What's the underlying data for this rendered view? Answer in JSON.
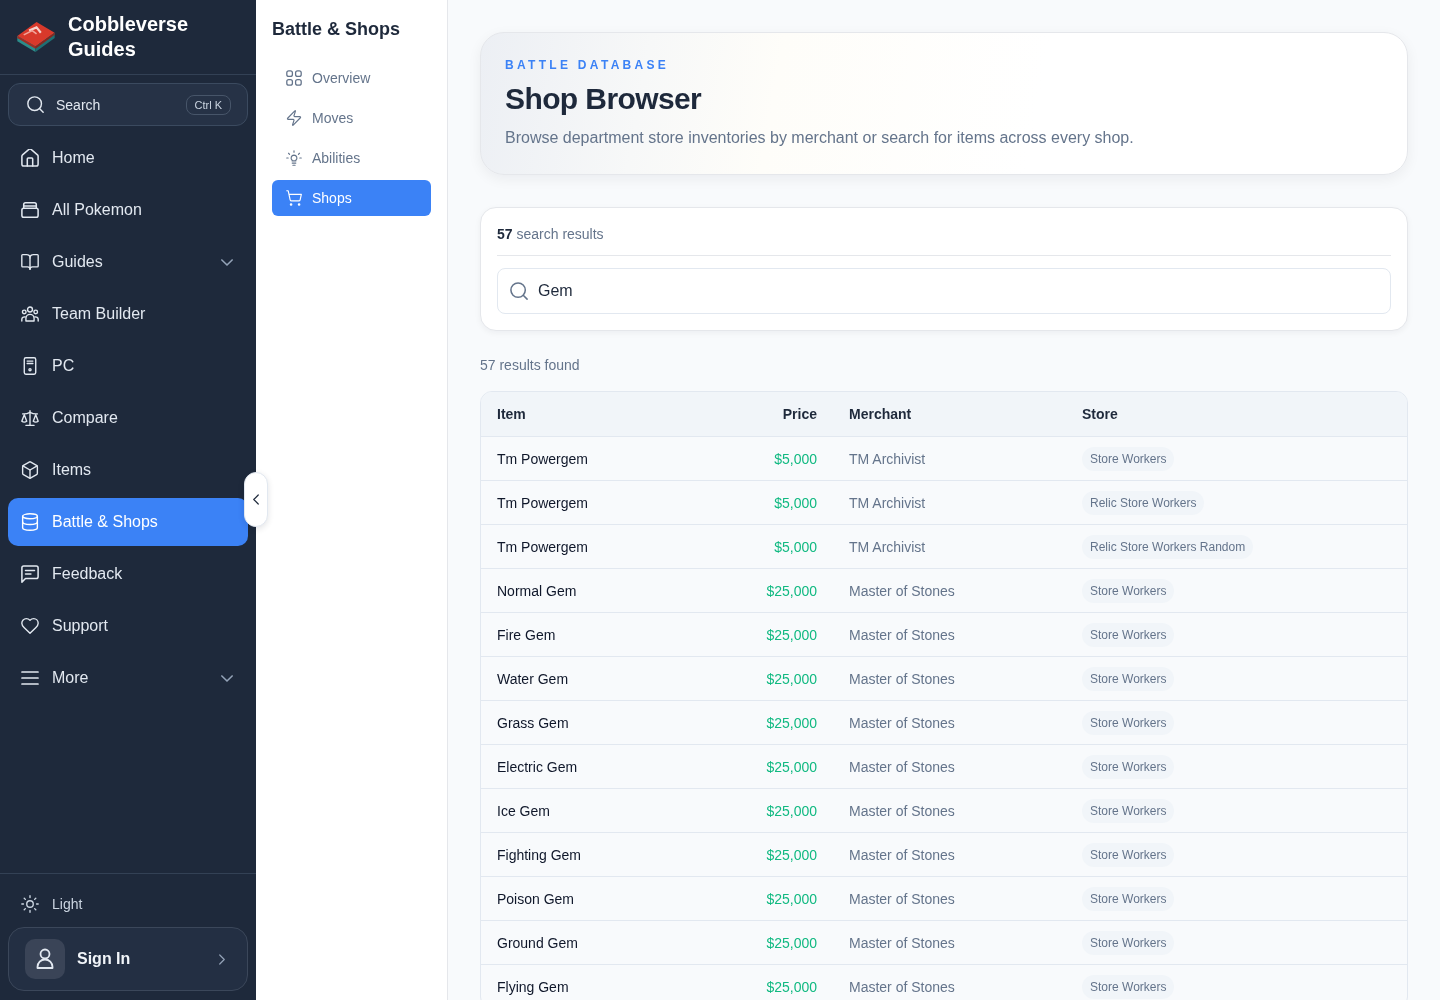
{
  "sidebar": {
    "brand": {
      "title": "Cobbleverse Guides"
    },
    "search": {
      "label": "Search",
      "shortcut": "Ctrl K"
    },
    "nav": [
      {
        "label": "Home",
        "kind": "link",
        "selected": false
      },
      {
        "label": "All Pokemon",
        "kind": "link",
        "selected": false
      },
      {
        "label": "Guides",
        "kind": "group",
        "expanded": false,
        "selected": false
      },
      {
        "label": "Team Builder",
        "kind": "link",
        "selected": false
      },
      {
        "label": "PC",
        "kind": "link",
        "selected": false
      },
      {
        "label": "Compare",
        "kind": "link",
        "selected": false
      },
      {
        "label": "Items",
        "kind": "link",
        "selected": false
      },
      {
        "label": "Battle & Shops",
        "kind": "link",
        "selected": true
      },
      {
        "label": "Feedback",
        "kind": "link",
        "selected": false
      },
      {
        "label": "Support",
        "kind": "link",
        "selected": false
      },
      {
        "label": "More",
        "kind": "group",
        "expanded": false,
        "selected": false
      }
    ],
    "theme": {
      "label": "Light"
    },
    "account": {
      "label": "Sign In"
    }
  },
  "section_nav": {
    "title": "Battle & Shops",
    "items": [
      {
        "label": "Overview",
        "selected": false
      },
      {
        "label": "Moves",
        "selected": false
      },
      {
        "label": "Abilities",
        "selected": false
      },
      {
        "label": "Shops",
        "selected": true
      }
    ]
  },
  "header": {
    "eyebrow": "BATTLE DATABASE",
    "title": "Shop Browser",
    "subtitle": "Browse department store inventories by merchant or search for items across every shop."
  },
  "search_panel": {
    "count": "**57** search results",
    "search": {
      "value": "Gem"
    }
  },
  "results_summary": "57 results found",
  "table": {
    "columns": [
      "Item",
      "Price",
      "Merchant",
      "Store"
    ],
    "rows": [
      {
        "item": "Tm Powergem",
        "price": "$5,000",
        "merchant": "TM Archivist",
        "store": "Store Workers"
      },
      {
        "item": "Tm Powergem",
        "price": "$5,000",
        "merchant": "TM Archivist",
        "store": "Relic Store Workers"
      },
      {
        "item": "Tm Powergem",
        "price": "$5,000",
        "merchant": "TM Archivist",
        "store": "Relic Store Workers Random"
      },
      {
        "item": "Normal Gem",
        "price": "$25,000",
        "merchant": "Master of Stones",
        "store": "Store Workers"
      },
      {
        "item": "Fire Gem",
        "price": "$25,000",
        "merchant": "Master of Stones",
        "store": "Store Workers"
      },
      {
        "item": "Water Gem",
        "price": "$25,000",
        "merchant": "Master of Stones",
        "store": "Store Workers"
      },
      {
        "item": "Grass Gem",
        "price": "$25,000",
        "merchant": "Master of Stones",
        "store": "Store Workers"
      },
      {
        "item": "Electric Gem",
        "price": "$25,000",
        "merchant": "Master of Stones",
        "store": "Store Workers"
      },
      {
        "item": "Ice Gem",
        "price": "$25,000",
        "merchant": "Master of Stones",
        "store": "Store Workers"
      },
      {
        "item": "Fighting Gem",
        "price": "$25,000",
        "merchant": "Master of Stones",
        "store": "Store Workers"
      },
      {
        "item": "Poison Gem",
        "price": "$25,000",
        "merchant": "Master of Stones",
        "store": "Store Workers"
      },
      {
        "item": "Ground Gem",
        "price": "$25,000",
        "merchant": "Master of Stones",
        "store": "Store Workers"
      },
      {
        "item": "Flying Gem",
        "price": "$25,000",
        "merchant": "Master of Stones",
        "store": "Store Workers"
      }
    ]
  }
}
